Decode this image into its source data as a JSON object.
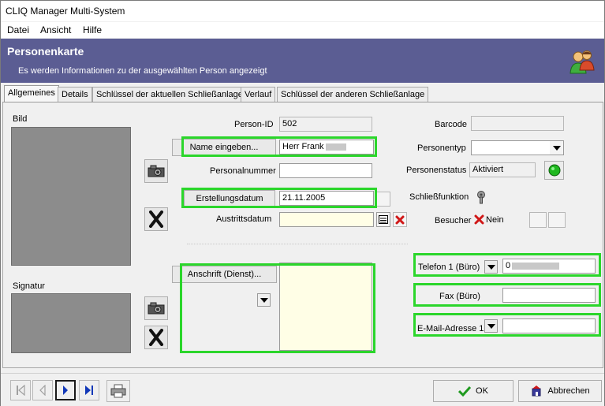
{
  "window": {
    "title": "CLIQ Manager Multi-System"
  },
  "menu": {
    "items": [
      "Datei",
      "Ansicht",
      "Hilfe"
    ]
  },
  "header": {
    "title": "Personenkarte",
    "subtitle": "Es werden Informationen zu der ausgewählten Person angezeigt"
  },
  "tabs": [
    "Allgemeines",
    "Details",
    "Schlüssel der aktuellen Schließanlage",
    "Verlauf",
    "Schlüssel der anderen Schließanlage"
  ],
  "left": {
    "bild_label": "Bild",
    "signatur_label": "Signatur"
  },
  "form": {
    "person_id_label": "Person-ID",
    "person_id_value": "502",
    "name_button": "Name eingeben...",
    "name_value": "Herr Frank",
    "personalnummer_label": "Personalnummer",
    "personalnummer_value": "",
    "erstellungsdatum_button": "Erstellungsdatum",
    "erstellungsdatum_value": "21.11.2005",
    "austrittsdatum_label": "Austrittsdatum",
    "austrittsdatum_value": "",
    "anschrift_button": "Anschrift (Dienst)...",
    "anschrift_value": ""
  },
  "right": {
    "barcode_label": "Barcode",
    "barcode_value": "",
    "personentyp_label": "Personentyp",
    "personentyp_value": "",
    "personenstatus_label": "Personenstatus",
    "personenstatus_value": "Aktiviert",
    "schliessfunktion_label": "Schließfunktion",
    "besucher_label": "Besucher",
    "besucher_value": "Nein",
    "telefon_label": "Telefon 1 (Büro)",
    "telefon_value": "0",
    "fax_label": "Fax (Büro)",
    "fax_value": "",
    "email_label": "E-Mail-Adresse 1",
    "email_value": ""
  },
  "footer": {
    "ok_label": "OK",
    "cancel_label": "Abbrechen"
  },
  "colors": {
    "header_bg": "#5b5d93",
    "highlight": "#2bd62b",
    "status_green": "#1fb81f"
  }
}
